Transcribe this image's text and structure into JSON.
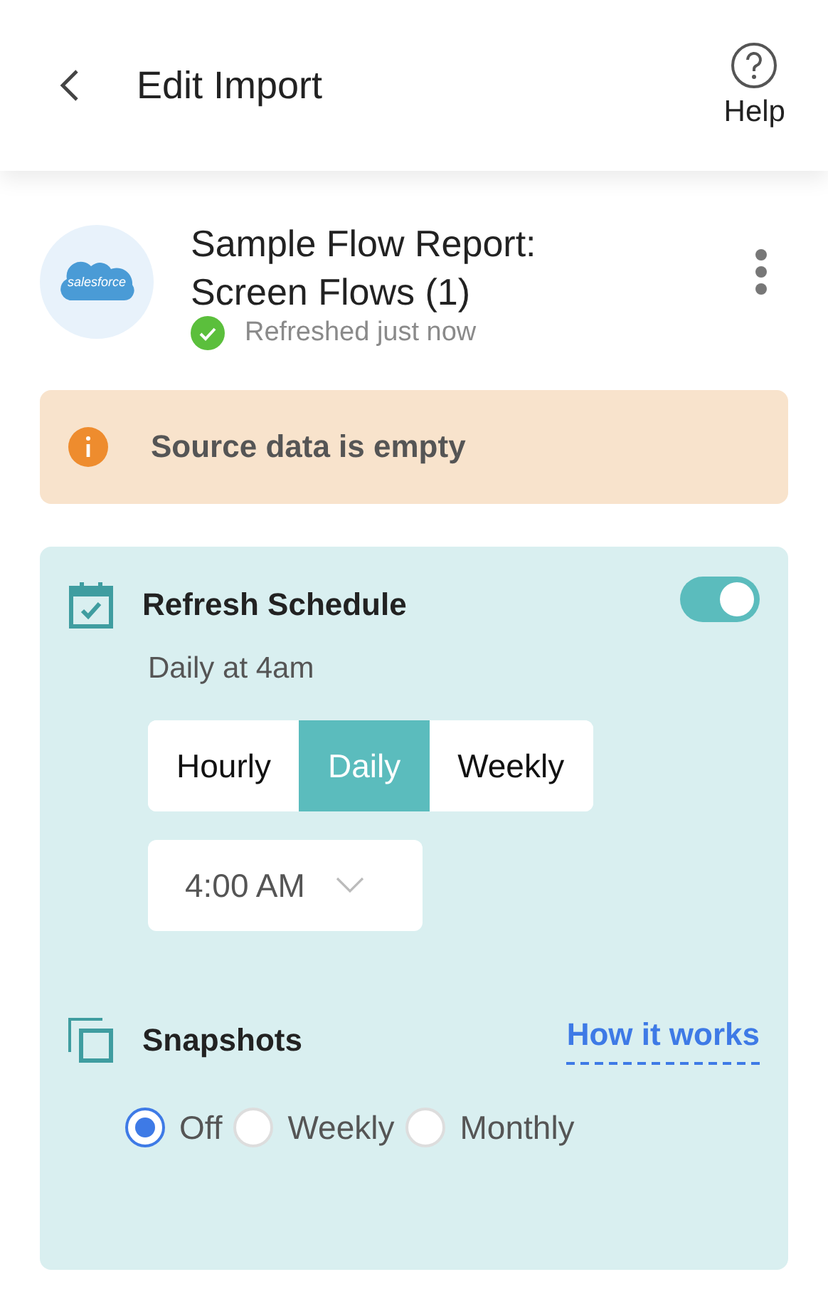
{
  "header": {
    "title": "Edit Import",
    "help_label": "Help"
  },
  "source": {
    "logo_text": "salesforce",
    "name": "Sample Flow Report: Screen Flows (1)",
    "status": "Refreshed just now"
  },
  "alert": {
    "message": "Source data is empty"
  },
  "schedule": {
    "title": "Refresh Schedule",
    "on": true,
    "summary": "Daily at 4am",
    "frequencies": [
      {
        "label": "Hourly",
        "selected": false
      },
      {
        "label": "Daily",
        "selected": true
      },
      {
        "label": "Weekly",
        "selected": false
      }
    ],
    "time": "4:00 AM"
  },
  "snapshots": {
    "title": "Snapshots",
    "link": "How it works",
    "options": [
      {
        "label": "Off",
        "selected": true
      },
      {
        "label": "Weekly",
        "selected": false
      },
      {
        "label": "Monthly",
        "selected": false
      }
    ]
  }
}
